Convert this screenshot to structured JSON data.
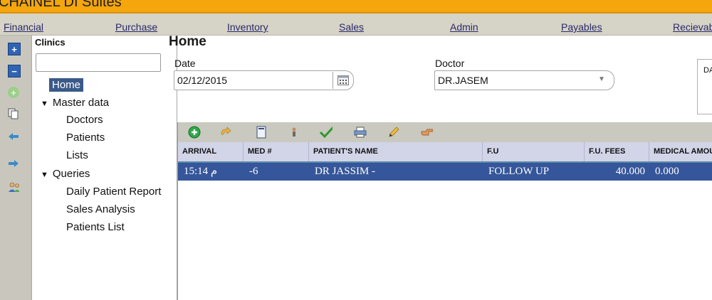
{
  "window": {
    "title": "CHAINEL DI Suites"
  },
  "menu": [
    "Financial",
    "Purchase",
    "Inventory",
    "Sales",
    "Admin",
    "Payables",
    "Recievables"
  ],
  "icon_strip": [
    "expand-plus-icon",
    "collapse-minus-icon",
    "add-disabled-icon",
    "copy-icon",
    "back-arrow-icon",
    "forward-arrow-icon",
    "users-icon"
  ],
  "tree": {
    "header": "Clinics",
    "search_value": "",
    "selected": "Home",
    "master_data": "Master data",
    "master_items": [
      "Doctors",
      "Patients",
      "Lists"
    ],
    "queries": "Queries",
    "query_items": [
      "Daily Patient Report",
      "Sales Analysis",
      "Patients List"
    ]
  },
  "page": {
    "title": "Home",
    "date_label": "Date",
    "date_value": "02/12/2015",
    "doctor_label": "Doctor",
    "doctor_value": "DR.JASEM",
    "right_panel_label": "DA"
  },
  "grid": {
    "toolbar": [
      "add-icon",
      "undo-icon",
      "document-icon",
      "person-icon",
      "check-icon",
      "print-icon",
      "edit-pencil-icon",
      "pointing-hand-icon"
    ],
    "columns": [
      "ARRIVAL",
      "MED #",
      "PATIENT'S NAME",
      "F.U",
      "F.U. FEES",
      "MEDICAL AMOUNT"
    ],
    "rows": [
      {
        "arrival": "15:14 م",
        "med": "-6",
        "name": "DR JASSIM -",
        "fu": "FOLLOW UP",
        "fees": "40.000",
        "medical": "0.000"
      }
    ]
  },
  "colors": {
    "titlebar": "#f5a60c",
    "selection": "#35569a",
    "header": "#d2d4e8",
    "toolbar": "#c9c9bf"
  }
}
